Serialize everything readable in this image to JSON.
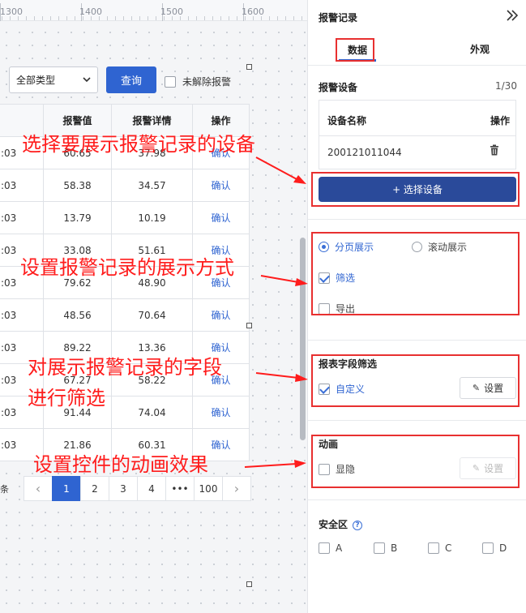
{
  "ruler": {
    "labels": [
      "1300",
      "1400",
      "1500",
      "1600"
    ]
  },
  "toolbar": {
    "type_select": "全部类型",
    "query_label": "查询",
    "unresolved_label": "未解除报警"
  },
  "table": {
    "headers": [
      "",
      "报警值",
      "报警详情",
      "操作"
    ],
    "rows": [
      {
        "time": ":03",
        "value": "60.65",
        "detail": "37.98",
        "action": "确认"
      },
      {
        "time": ":03",
        "value": "58.38",
        "detail": "34.57",
        "action": "确认"
      },
      {
        "time": ":03",
        "value": "13.79",
        "detail": "10.19",
        "action": "确认"
      },
      {
        "time": ":03",
        "value": "33.08",
        "detail": "51.61",
        "action": "确认"
      },
      {
        "time": ":03",
        "value": "79.62",
        "detail": "48.90",
        "action": "确认"
      },
      {
        "time": ":03",
        "value": "48.56",
        "detail": "70.64",
        "action": "确认"
      },
      {
        "time": ":03",
        "value": "89.22",
        "detail": "13.36",
        "action": "确认"
      },
      {
        "time": ":03",
        "value": "67.27",
        "detail": "58.22",
        "action": "确认"
      },
      {
        "time": ":03",
        "value": "91.44",
        "detail": "74.04",
        "action": "确认"
      },
      {
        "time": ":03",
        "value": "21.86",
        "detail": "60.31",
        "action": "确认"
      }
    ]
  },
  "pager": {
    "tail": "条",
    "prev": "‹",
    "pages": [
      "1",
      "2",
      "3",
      "4",
      "•••",
      "100"
    ],
    "next": "›",
    "active": "1"
  },
  "annotations": {
    "select_device": "选择要展示报警记录的设备",
    "display_mode": "设置报警记录的展示方式",
    "field_filter_line1": "对展示报警记录的字段",
    "field_filter_line2": "进行筛选",
    "animation": "设置控件的动画效果"
  },
  "panel": {
    "title": "报警记录",
    "tabs": {
      "data": "数据",
      "appearance": "外观"
    },
    "device": {
      "title": "报警设备",
      "count": "1/30",
      "col_name": "设备名称",
      "col_action": "操作",
      "rows": [
        "200121011044"
      ],
      "select_button": "+ 选择设备"
    },
    "display": {
      "paged": "分页展示",
      "scroll": "滚动展示",
      "filter": "筛选",
      "export": "导出"
    },
    "field_filter": {
      "title": "报表字段筛选",
      "custom": "自定义",
      "set_button": "设置"
    },
    "animation": {
      "title": "动画",
      "toggle": "显隐",
      "set_button": "设置"
    },
    "safe_zone": {
      "title": "安全区",
      "help": "?",
      "options": [
        "A",
        "B",
        "C",
        "D"
      ]
    }
  },
  "colors": {
    "primary": "#2f64d1",
    "button_dark": "#2a4a9a",
    "annotation": "#ff1c1c"
  }
}
